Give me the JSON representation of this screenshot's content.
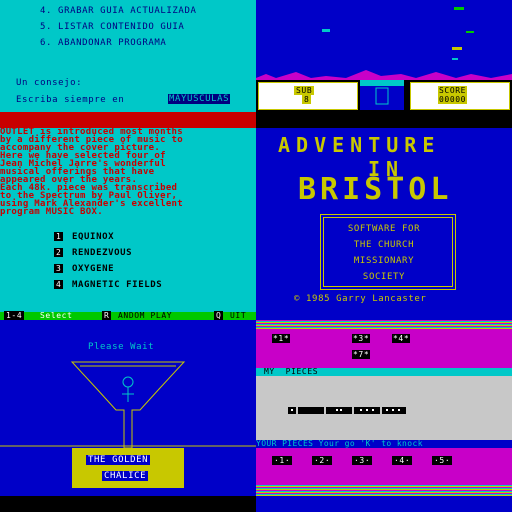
{
  "menu": {
    "items": [
      "4. GRABAR GUIA ACTUALIZADA",
      "5. LISTAR CONTENIDO GUIA",
      "6. ABANDONAR PROGRAMA"
    ],
    "tip_label": "Un consejo:",
    "tip_text": "Escriba siempre en",
    "tip_highlight": "MAYUSCULAS"
  },
  "game": {
    "sub_label": "SUB",
    "sub_value": "8",
    "score_label": "SCORE",
    "score_value": "00000"
  },
  "outlet": {
    "lines": [
      "OUTLET is introduced most months",
      "by a different piece of music to",
      "accompany the cover picture.",
      "Here we have selected four of",
      "Jean Michel Jarre's wonderful",
      "musical offerings that have",
      "appeared over the years.",
      "Each 48k. piece was transcribed",
      "to the Spectrum by Paul Oliver,",
      "using Mark Alexander's excellent",
      "program MUSIC BOX."
    ],
    "tracks": [
      {
        "num": "1",
        "title": "EQUINOX"
      },
      {
        "num": "2",
        "title": "RENDEZVOUS"
      },
      {
        "num": "3",
        "title": "OXYGENE"
      },
      {
        "num": "4",
        "title": "MAGNETIC FIELDS"
      }
    ],
    "footer": {
      "k1": "1-4",
      "l1": "Select",
      "k2": "R",
      "l2": "ANDOM PLAY",
      "k3": "Q",
      "l3": "UIT"
    }
  },
  "adventure": {
    "title1": "ADVENTURE",
    "title2": "IN",
    "title3": "BRISTOL",
    "box_lines": [
      "SOFTWARE FOR",
      "THE CHURCH",
      "MISSIONARY",
      "SOCIETY"
    ],
    "copyright": "© 1985 Garry Lancaster"
  },
  "chalice": {
    "status": "Please Wait",
    "title1": "THE GOLDEN",
    "title2": "CHALICE"
  },
  "dominoes": {
    "top_tiles": [
      "*1*",
      "*3*",
      "*4*",
      "*7*"
    ],
    "my_pieces_label": "MY  PIECES",
    "your_pieces_label": "YOUR PIECES Your go 'K' to knock",
    "choices": [
      "·1·",
      "·2·",
      "·3·",
      "·4·",
      "·5·"
    ]
  },
  "colors": {
    "cyan": "#00C8C8",
    "blue": "#0000C8",
    "magenta": "#C800C8",
    "yellow": "#C8C800",
    "green": "#00C800",
    "red": "#C80000"
  }
}
